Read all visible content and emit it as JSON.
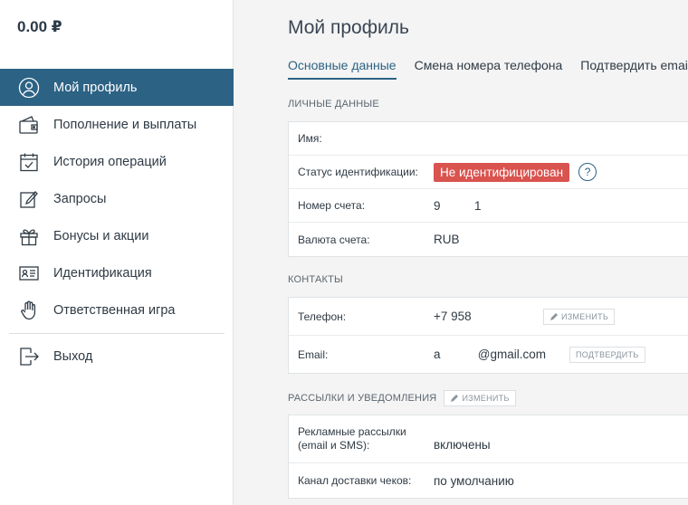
{
  "sidebar": {
    "balance": "0.00 ₽",
    "items": [
      {
        "label": "Мой профиль",
        "icon": "user-circle-icon"
      },
      {
        "label": "Пополнение и выплаты",
        "icon": "wallet-icon"
      },
      {
        "label": "История операций",
        "icon": "calendar-check-icon"
      },
      {
        "label": "Запросы",
        "icon": "edit-icon"
      },
      {
        "label": "Бонусы и акции",
        "icon": "gift-icon"
      },
      {
        "label": "Идентификация",
        "icon": "id-card-icon"
      },
      {
        "label": "Ответственная игра",
        "icon": "hand-icon"
      }
    ],
    "logout": {
      "label": "Выход",
      "icon": "logout-icon"
    }
  },
  "main": {
    "title": "Мой профиль",
    "tabs": [
      {
        "label": "Основные данные"
      },
      {
        "label": "Смена номера телефона"
      },
      {
        "label": "Подтвердить email"
      }
    ],
    "personal": {
      "section_label": "ЛИЧНЫЕ ДАННЫЕ",
      "name_label": "Имя:",
      "name_value": "",
      "status_label": "Статус идентификации:",
      "status_value": "Не идентифицирован",
      "help": "?",
      "account_label": "Номер счета:",
      "account_value": "9          1",
      "currency_label": "Валюта счета:",
      "currency_value": "RUB"
    },
    "contacts": {
      "section_label": "КОНТАКТЫ",
      "phone_label": "Телефон:",
      "phone_value": "+7 958",
      "phone_button": "ИЗМЕНИТЬ",
      "email_label": "Email:",
      "email_value": "a           @gmail.com",
      "email_button": "ПОДТВЕРДИТЬ"
    },
    "notifications": {
      "section_label": "РАССЫЛКИ И УВЕДОМЛЕНИЯ",
      "edit_button": "ИЗМЕНИТЬ",
      "ads_label_line1": "Рекламные рассылки",
      "ads_label_line2": "(email и SMS):",
      "ads_value": "включены",
      "receipt_label": "Канал доставки чеков:",
      "receipt_value": "по умолчанию"
    }
  },
  "colors": {
    "accent": "#2c6284",
    "danger": "#d9534f"
  }
}
